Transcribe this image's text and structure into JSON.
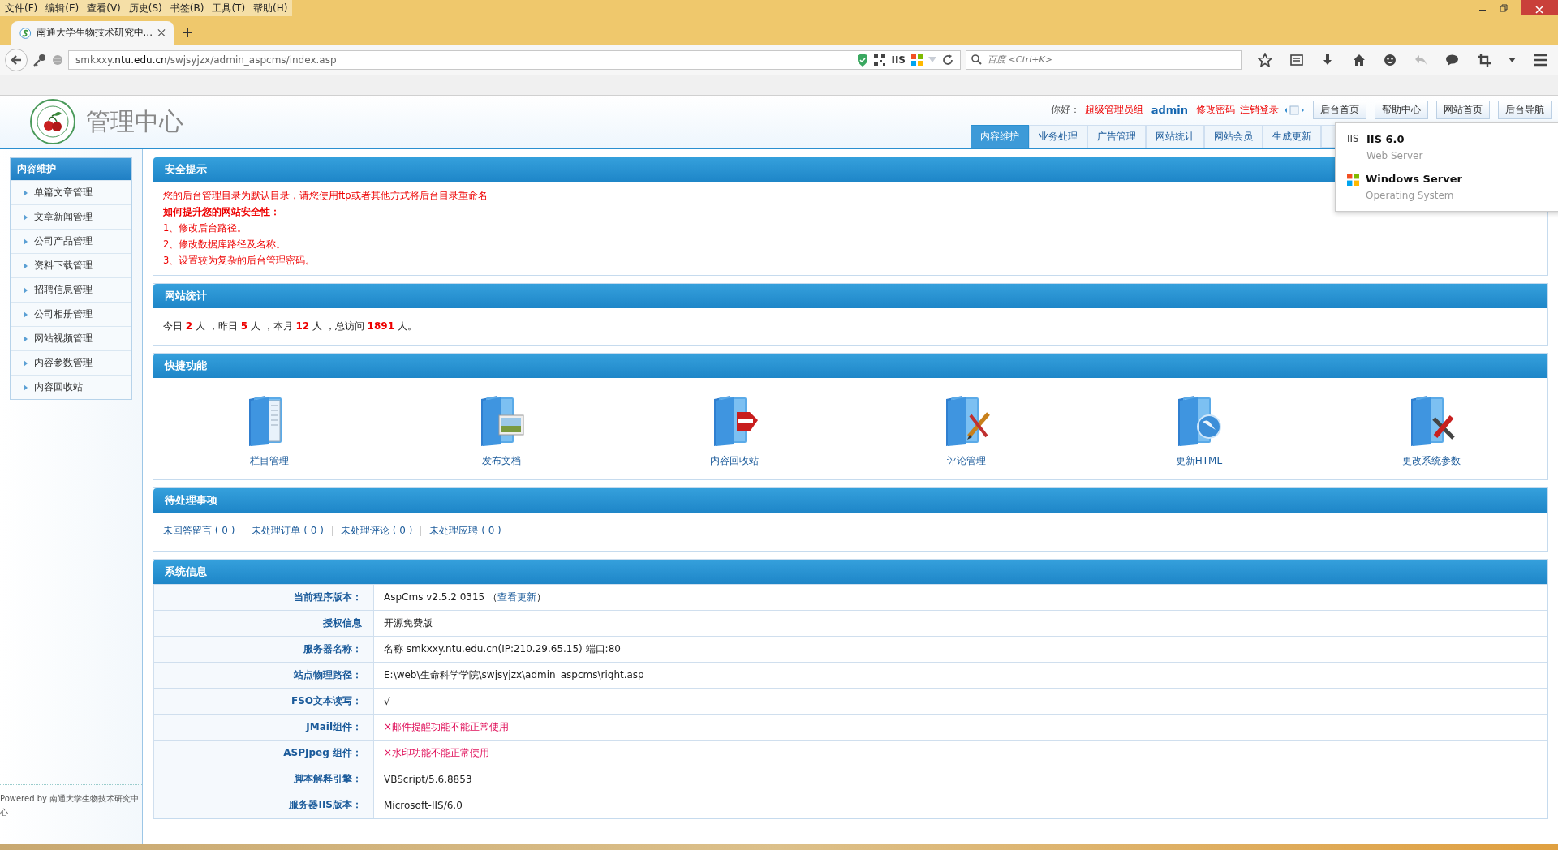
{
  "browser": {
    "menu": [
      "文件(F)",
      "编辑(E)",
      "查看(V)",
      "历史(S)",
      "书签(B)",
      "工具(T)",
      "帮助(H)"
    ],
    "tab_title": "南通大学生物技术研究中...",
    "url_prefix": "smkxxy.",
    "url_domain": "ntu.edu.cn",
    "url_path": "/swjsyjzx/admin_aspcms/index.asp",
    "server_badge": "IIS",
    "search_placeholder": "百度 <Ctrl+K>"
  },
  "header": {
    "title": "管理中心",
    "greeting": "你好：",
    "role": "超级管理员组",
    "user": "admin",
    "links": [
      "修改密码",
      "注销登录"
    ],
    "buttons": [
      "后台首页",
      "帮助中心",
      "网站首页",
      "后台导航"
    ],
    "tabs": [
      {
        "label": "内容维护",
        "selected": true
      },
      {
        "label": "业务处理",
        "selected": false
      },
      {
        "label": "广告管理",
        "selected": false
      },
      {
        "label": "网站统计",
        "selected": false
      },
      {
        "label": "网站会员",
        "selected": false
      },
      {
        "label": "生成更新",
        "selected": false
      }
    ]
  },
  "popup": {
    "items": [
      {
        "kind": "iis",
        "icon_text": "IIS",
        "title": "IIS 6.0",
        "subtitle": "Web Server"
      },
      {
        "kind": "windows",
        "title": "Windows Server",
        "subtitle": "Operating System"
      }
    ]
  },
  "sidebar": {
    "title": "内容维护",
    "items": [
      "单篇文章管理",
      "文章新闻管理",
      "公司产品管理",
      "资料下载管理",
      "招聘信息管理",
      "公司相册管理",
      "网站视频管理",
      "内容参数管理",
      "内容回收站"
    ],
    "footer": "Powered by 南通大学生物技术研究中心"
  },
  "security": {
    "title": "安全提示",
    "notice": "您的后台管理目录为默认目录，请您使用ftp或者其他方式将后台目录重命名",
    "heading": "如何提升您的网站安全性：",
    "items": [
      "1、修改后台路径。",
      "2、修改数据库路径及名称。",
      "3、设置较为复杂的后台管理密码。"
    ]
  },
  "stats": {
    "title": "网站统计",
    "text": "今日 **2** 人 ，昨日 **5** 人 ，本月 **12** 人 ，总访问 **1891** 人。"
  },
  "quick": {
    "title": "快捷功能",
    "items": [
      {
        "label": "栏目管理",
        "kind": "pages"
      },
      {
        "label": "发布文档",
        "kind": "photo"
      },
      {
        "label": "内容回收站",
        "kind": "stop"
      },
      {
        "label": "评论管理",
        "kind": "pen"
      },
      {
        "label": "更新HTML",
        "kind": "globe"
      },
      {
        "label": "更改系统参数",
        "kind": "tools"
      }
    ]
  },
  "pending": {
    "title": "待处理事项",
    "items": [
      "未回答留言 ( 0 )",
      "未处理订单 ( 0 )",
      "未处理评论 ( 0 )",
      "未处理应聘 ( 0 )"
    ]
  },
  "sysinfo": {
    "title": "系统信息",
    "rows": [
      {
        "label": "当前程序版本：",
        "value": "AspCms v2.5.2 0315 （",
        "link": "查看更新",
        "value_after": "）",
        "kind": "plain"
      },
      {
        "label": "授权信息",
        "value": "开源免费版",
        "kind": "plain"
      },
      {
        "label": "服务器名称：",
        "value": "名称 smkxxy.ntu.edu.cn(IP:210.29.65.15) 端口:80",
        "kind": "plain"
      },
      {
        "label": "站点物理路径：",
        "value": "E:\\web\\生命科学学院\\swjsyjzx\\admin_aspcms\\right.asp",
        "kind": "plain"
      },
      {
        "label": "FSO文本读写：",
        "value": "√",
        "kind": "plain"
      },
      {
        "label": "JMail组件：",
        "value": "×邮件提醒功能不能正常使用",
        "kind": "error"
      },
      {
        "label": "ASPJpeg 组件：",
        "value": "×水印功能不能正常使用",
        "kind": "error"
      },
      {
        "label": "脚本解释引擎：",
        "value": "VBScript/5.6.8853",
        "kind": "plain"
      },
      {
        "label": "服务器IIS版本：",
        "value": "Microsoft-IIS/6.0",
        "kind": "plain"
      }
    ]
  }
}
